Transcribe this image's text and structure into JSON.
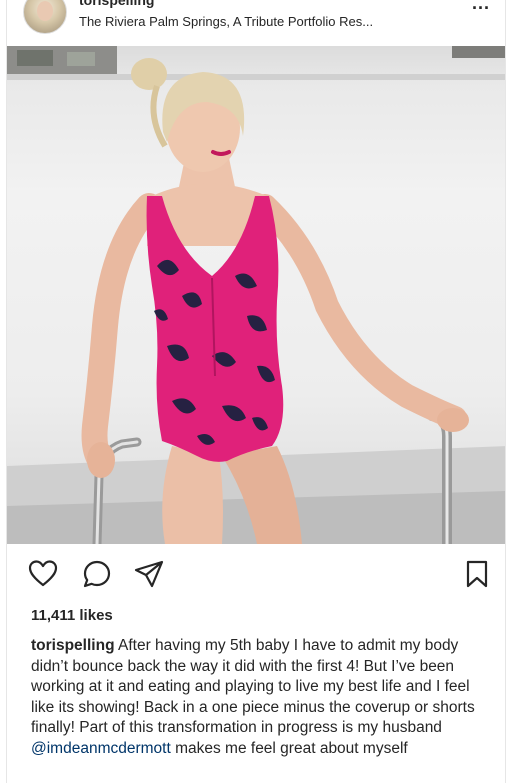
{
  "post": {
    "username": "torispelling",
    "location": "The Riviera Palm Springs, A Tribute Portfolio Res...",
    "more_label": "...",
    "likes": "11,411 likes",
    "caption_user": "torispelling",
    "caption_text": " After having my 5th baby I have to admit my body didn’t bounce back the way it did with the first 4! But I’ve been working at it and eating and playing to live my best life and I feel like its showing! Back in a one piece minus the coverup or shorts finally! Part of this transformation in progress is my husband ",
    "caption_mention": "@imdeanmcdermott",
    "caption_tail": " makes me feel great about myself"
  },
  "icons": {
    "like": "heart-icon",
    "comment": "comment-icon",
    "share": "paper-plane-icon",
    "save": "bookmark-icon"
  },
  "colors": {
    "text": "#262626",
    "mention": "#003569",
    "swimsuit_pink": "#e0217a",
    "swimsuit_dark": "#1d2240"
  }
}
